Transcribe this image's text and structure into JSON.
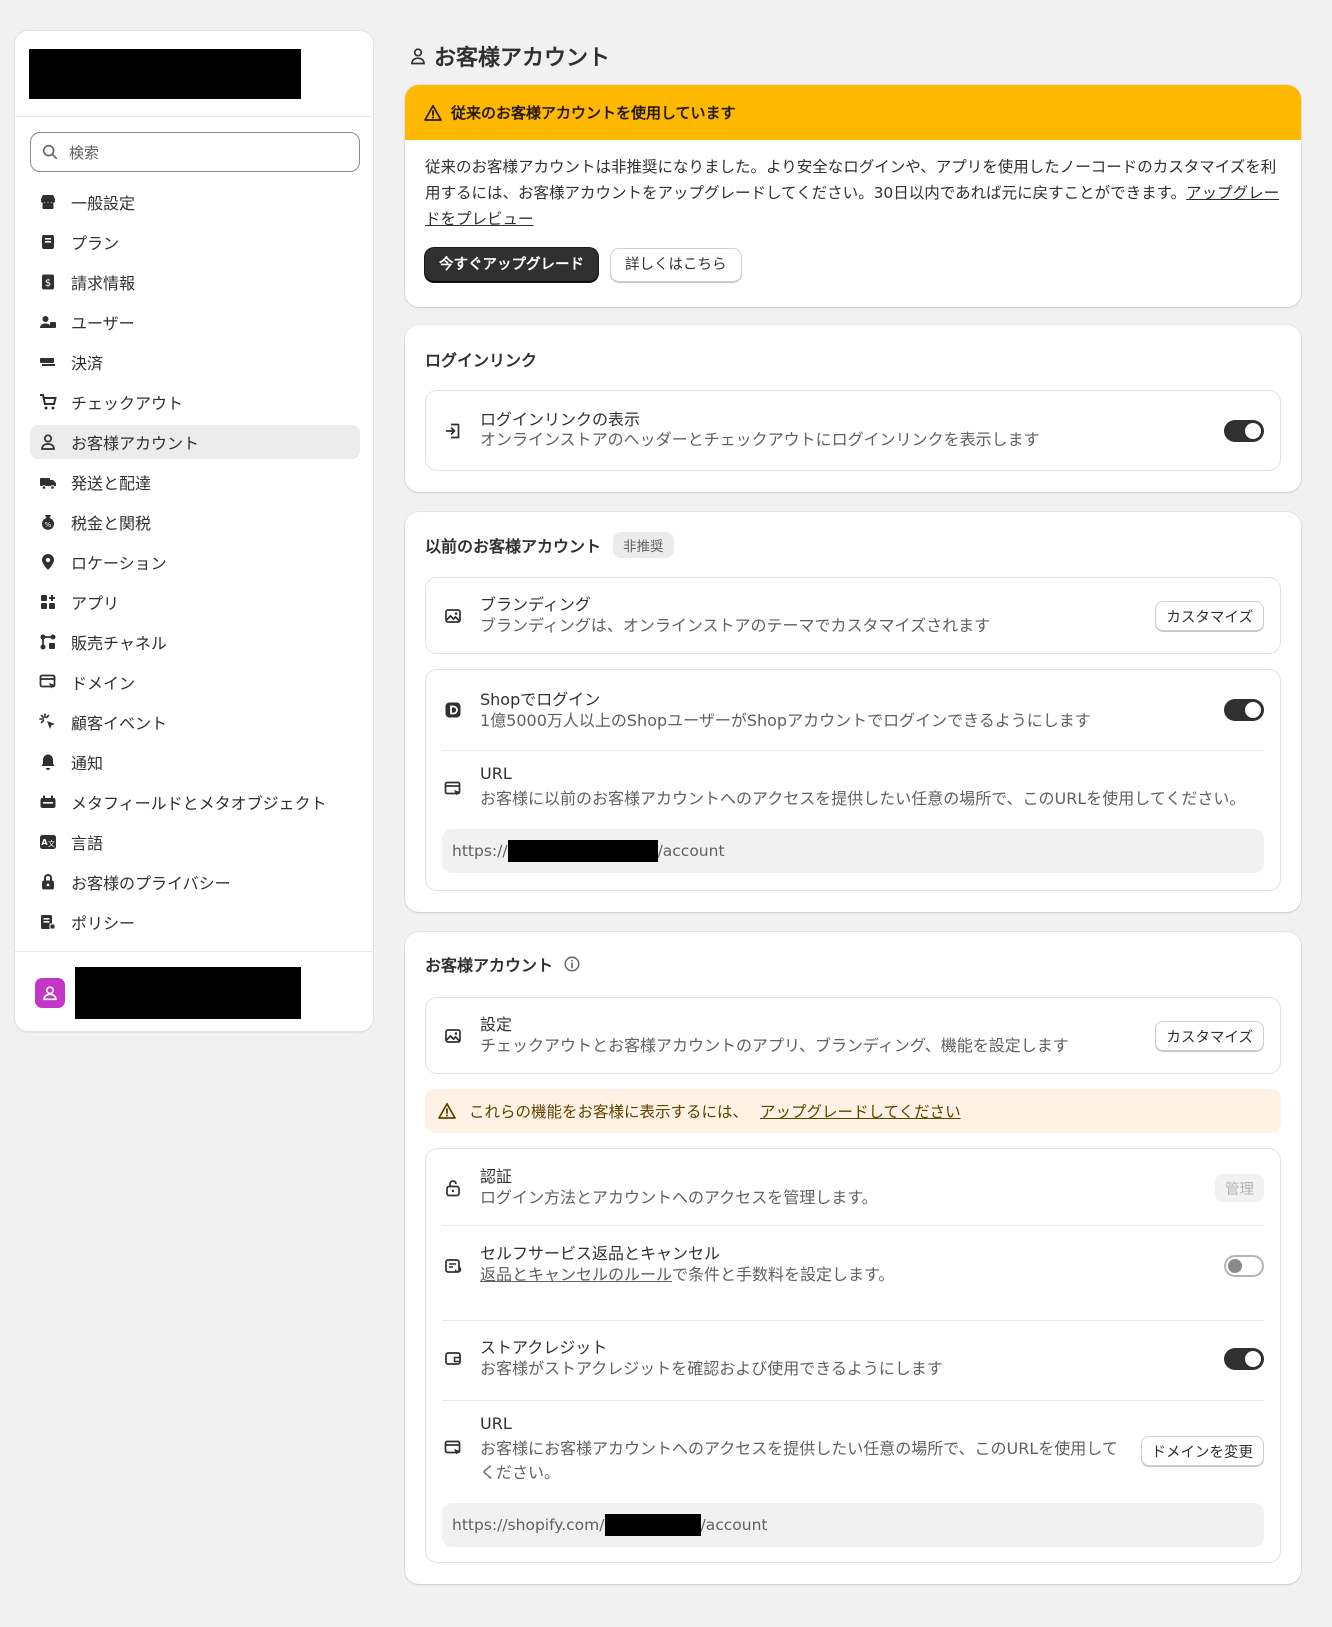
{
  "sidebar": {
    "search_placeholder": "検索",
    "items": [
      {
        "label": "一般設定",
        "icon": "store-icon"
      },
      {
        "label": "プラン",
        "icon": "plan-icon"
      },
      {
        "label": "請求情報",
        "icon": "billing-icon"
      },
      {
        "label": "ユーザー",
        "icon": "users-icon"
      },
      {
        "label": "決済",
        "icon": "payments-icon"
      },
      {
        "label": "チェックアウト",
        "icon": "cart-icon"
      },
      {
        "label": "お客様アカウント",
        "icon": "person-icon",
        "active": true
      },
      {
        "label": "発送と配達",
        "icon": "truck-icon"
      },
      {
        "label": "税金と関税",
        "icon": "tax-icon"
      },
      {
        "label": "ロケーション",
        "icon": "location-icon"
      },
      {
        "label": "アプリ",
        "icon": "apps-icon"
      },
      {
        "label": "販売チャネル",
        "icon": "channels-icon"
      },
      {
        "label": "ドメイン",
        "icon": "domain-icon"
      },
      {
        "label": "顧客イベント",
        "icon": "cursor-icon"
      },
      {
        "label": "通知",
        "icon": "bell-icon"
      },
      {
        "label": "メタフィールドとメタオブジェクト",
        "icon": "metafield-icon"
      },
      {
        "label": "言語",
        "icon": "language-icon"
      },
      {
        "label": "お客様のプライバシー",
        "icon": "lock-icon"
      },
      {
        "label": "ポリシー",
        "icon": "policy-icon"
      }
    ]
  },
  "page": {
    "title": "お客様アカウント"
  },
  "banner": {
    "title": "従来のお客様アカウントを使用しています",
    "body": "従来のお客様アカウントは非推奨になりました。より安全なログインや、アプリを使用したノーコードのカスタマイズを利用するには、お客様アカウントをアップグレードしてください。30日以内であれば元に戻すことができます。",
    "link": "アップグレードをプレビュー",
    "primary_button": "今すぐアップグレード",
    "secondary_button": "詳しくはこちら"
  },
  "login_link": {
    "section_title": "ログインリンク",
    "title": "ログインリンクの表示",
    "description": "オンラインストアのヘッダーとチェックアウトにログインリンクを表示します",
    "enabled": true
  },
  "legacy": {
    "section_title": "以前のお客様アカウント",
    "badge": "非推奨",
    "branding_title": "ブランディング",
    "branding_desc": "ブランディングは、オンラインストアのテーマでカスタマイズされます",
    "branding_button": "カスタマイズ",
    "shop_title": "Shopでログイン",
    "shop_desc": "1億5000万人以上のShopユーザーがShopアカウントでログインできるようにします",
    "shop_enabled": true,
    "url_title": "URL",
    "url_desc": "お客様に以前のお客様アカウントへのアクセスを提供したい任意の場所で、このURLを使用してください。",
    "url_prefix": "https://",
    "url_suffix": "/account"
  },
  "accounts": {
    "section_title": "お客様アカウント",
    "settings_title": "設定",
    "settings_desc": "チェックアウトとお客様アカウントのアプリ、ブランディング、機能を設定します",
    "settings_button": "カスタマイズ",
    "warning_text": "これらの機能をお客様に表示するには、",
    "warning_link": "アップグレードしてください",
    "auth_title": "認証",
    "auth_desc": "ログイン方法とアカウントへのアクセスを管理します。",
    "auth_button": "管理",
    "returns_title": "セルフサービス返品とキャンセル",
    "returns_link": "返品とキャンセルのルール",
    "returns_desc_rest": "で条件と手数料を設定します。",
    "returns_enabled": false,
    "credit_title": "ストアクレジット",
    "credit_desc": "お客様がストアクレジットを確認および使用できるようにします",
    "credit_enabled": true,
    "url_title": "URL",
    "url_desc": "お客様にお客様アカウントへのアクセスを提供したい任意の場所で、このURLを使用してください。",
    "url_button": "ドメインを変更",
    "url_prefix": "https://shopify.com/",
    "url_suffix": "/account"
  },
  "colors": {
    "banner": "#ffb800",
    "warning_bg": "#fff1e3",
    "avatar": "#c336c8"
  }
}
